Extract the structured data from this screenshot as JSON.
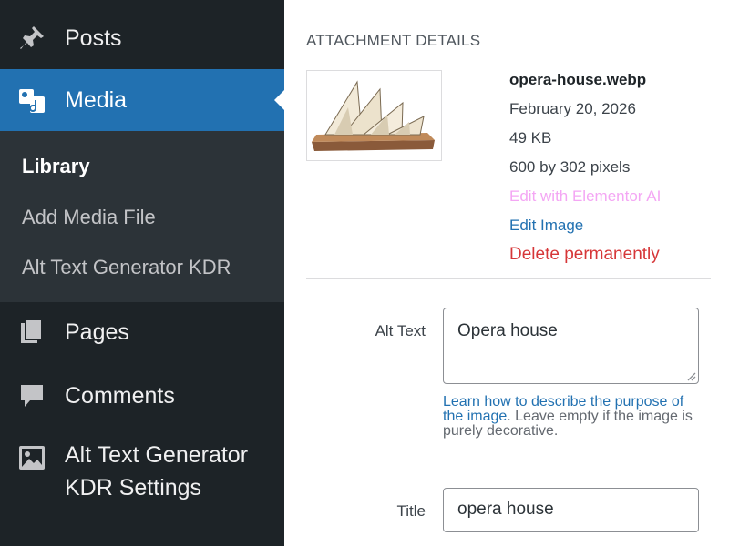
{
  "sidebar": {
    "posts_label": "Posts",
    "media_label": "Media",
    "submenu": [
      "Library",
      "Add Media File",
      "Alt Text Generator KDR"
    ],
    "pages_label": "Pages",
    "comments_label": "Comments",
    "kdr_settings_line1": "Alt Text Generator",
    "kdr_settings_line2": "KDR Settings"
  },
  "attachment": {
    "heading": "ATTACHMENT DETAILS",
    "filename": "opera-house.webp",
    "date": "February 20, 2026",
    "size": "49 KB",
    "dimensions": "600 by 302 pixels",
    "edit_elementor": "Edit with Elementor AI",
    "edit_image": "Edit Image",
    "delete": "Delete permanently"
  },
  "fields": {
    "alt_label": "Alt Text",
    "alt_value": "Opera house",
    "help_link": "Learn how to describe the purpose of the image",
    "help_rest": ". Leave empty if the image is purely decorative.",
    "title_label": "Title",
    "title_value": "opera house"
  },
  "colors": {
    "sidebar_bg": "#1d2327",
    "submenu_bg": "#2c3338",
    "active_blue": "#2271b1",
    "delete_red": "#d63638",
    "elementor_pink": "#f4a6f4"
  }
}
